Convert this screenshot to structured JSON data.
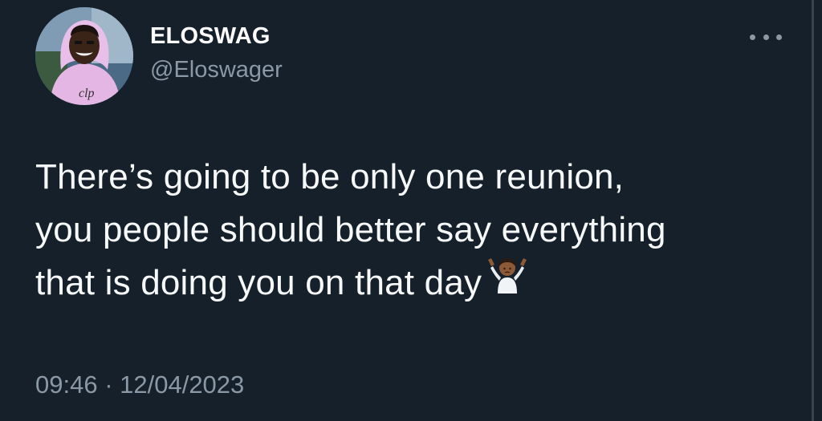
{
  "user": {
    "display_name": "ELOSWAG",
    "handle": "@Eloswager",
    "avatar_icon": "profile-photo-person-pink-hoodie"
  },
  "tweet": {
    "text_lines": [
      "There’s going to be only one reunion,",
      "you people should better say everything",
      "that is doing you on that day"
    ],
    "emoji": "🤷🏾‍♂️",
    "emoji_icon": "person-shrugging-icon",
    "timestamp": "09:46 · 12/04/2023"
  },
  "menu": {
    "icon": "more-options-icon"
  },
  "colors": {
    "background": "#15202b",
    "primary_text": "#f7f9f9",
    "secondary_text": "#8b98a5"
  }
}
